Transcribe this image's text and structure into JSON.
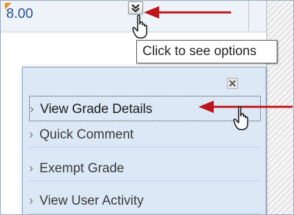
{
  "grade_cell": {
    "value": "8.00",
    "menu_button_icon": "chevron-down-icon"
  },
  "tooltip": {
    "text": "Click to see options"
  },
  "context_menu": {
    "close_icon": "close-icon",
    "items": [
      {
        "label": "View Grade Details",
        "active": true
      },
      {
        "label": "Quick Comment",
        "active": false
      },
      {
        "label": "Exempt Grade",
        "active": false
      },
      {
        "label": "View User Activity",
        "active": false
      }
    ]
  },
  "annotations": {
    "arrow_color": "#c0131a",
    "highlight_icon": "pointer-hand-icon"
  },
  "colors": {
    "grade_text": "#2b4f92",
    "menu_background": "#dce8f6",
    "flag_triangle": "#e39a2c"
  }
}
